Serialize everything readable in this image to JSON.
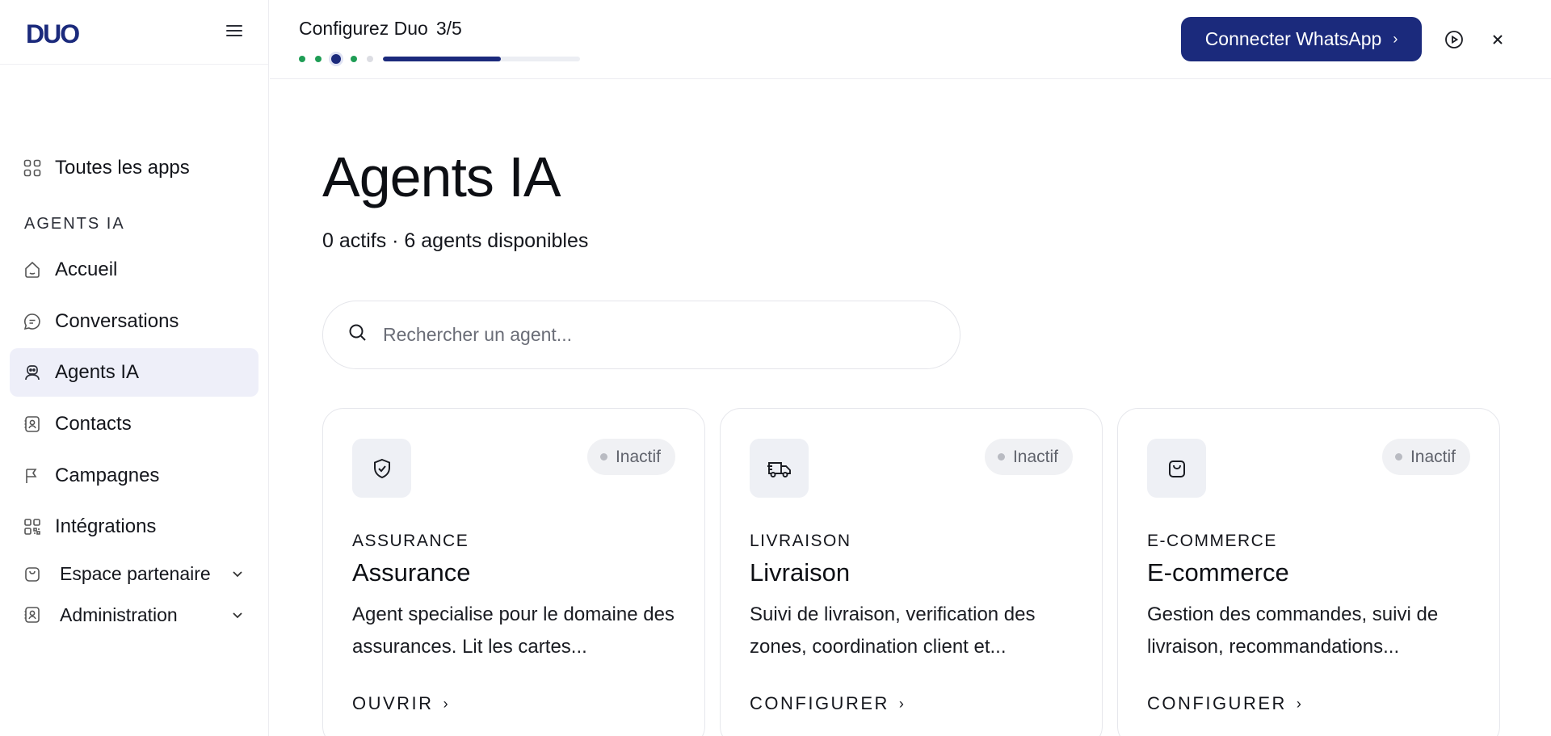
{
  "sidebar": {
    "logo": "DUO",
    "menu_icon": "hamburger-icon",
    "all_apps": "Toutes les apps",
    "section": "AGENTS IA",
    "items": [
      {
        "label": "Accueil",
        "icon": "home-icon"
      },
      {
        "label": "Conversations",
        "icon": "chat-icon"
      },
      {
        "label": "Agents IA",
        "icon": "robot-icon",
        "active": true
      },
      {
        "label": "Contacts",
        "icon": "contact-card-icon"
      },
      {
        "label": "Campagnes",
        "icon": "flag-icon"
      },
      {
        "label": "Intégrations",
        "icon": "qr-grid-icon"
      }
    ],
    "groups": [
      {
        "label": "Espace partenaire",
        "icon": "bag-icon"
      },
      {
        "label": "Administration",
        "icon": "contact-card-icon"
      }
    ]
  },
  "topbar": {
    "setup_title": "Configurez Duo",
    "setup_step": "3/5",
    "progress_fraction": 0.6,
    "cta_label": "Connecter WhatsApp",
    "cta_arrow": "›",
    "play_icon": "play-circle-icon",
    "close_icon": "close-icon"
  },
  "main": {
    "title": "Agents IA",
    "subtitle": "0 actifs · 6 agents disponibles",
    "search_placeholder": "Rechercher un agent...",
    "cards": [
      {
        "icon": "shield-check-icon",
        "status": "Inactif",
        "category": "ASSURANCE",
        "name": "Assurance",
        "description": "Agent specialise pour le domaine des assurances. Lit les cartes...",
        "action": "OUVRIR"
      },
      {
        "icon": "truck-icon",
        "status": "Inactif",
        "category": "LIVRAISON",
        "name": "Livraison",
        "description": "Suivi de livraison, verification des zones, coordination client et...",
        "action": "CONFIGURER"
      },
      {
        "icon": "shopping-bag-icon",
        "status": "Inactif",
        "category": "E-COMMERCE",
        "name": "E-commerce",
        "description": "Gestion des commandes, suivi de livraison, recommandations...",
        "action": "CONFIGURER"
      }
    ]
  },
  "colors": {
    "brand": "#1b2a7c",
    "step_done": "#1f9d55",
    "active_nav_bg": "#eeeff9"
  }
}
